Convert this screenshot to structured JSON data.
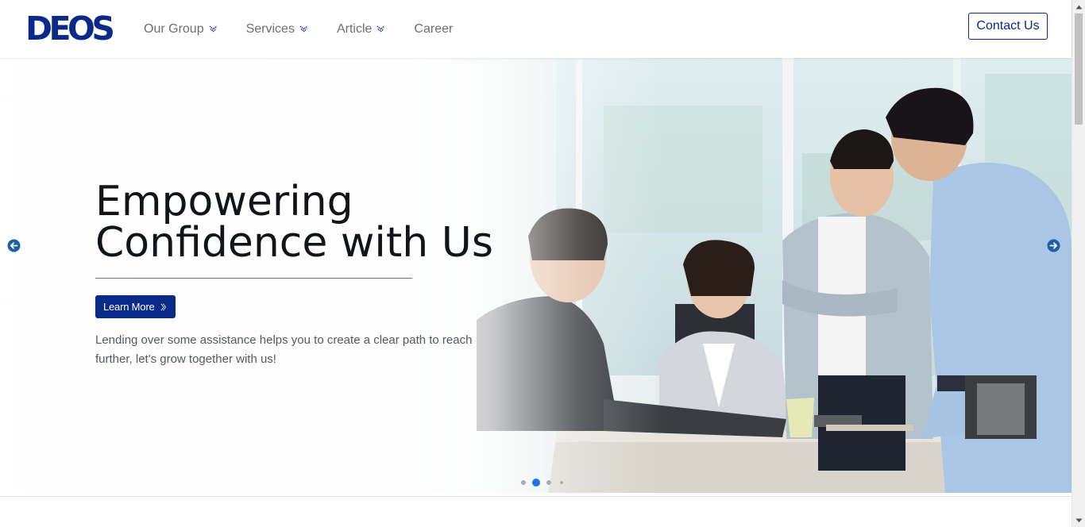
{
  "header": {
    "logo_text": "DEOS",
    "nav": [
      {
        "label": "Our Group",
        "has_dropdown": true
      },
      {
        "label": "Services",
        "has_dropdown": true
      },
      {
        "label": "Article",
        "has_dropdown": true
      },
      {
        "label": "Career",
        "has_dropdown": false
      }
    ],
    "contact_label": "Contact Us"
  },
  "hero": {
    "title_line1": "Empowering",
    "title_line2": "Confidence with Us",
    "button_label": "Learn More",
    "description": "Lending over some assistance helps you to create a clear path to reach further, let's grow together with us!",
    "slides_total": 4,
    "active_slide": 2
  },
  "icons": {
    "prev": "arrow-circle-left-icon",
    "next": "arrow-circle-right-icon",
    "dropdown": "chevron-down-icon",
    "button_arrow": "chevron-right-icon"
  },
  "colors": {
    "brand": "#0a2a8a",
    "arrow": "#1f5fa8",
    "dot_active": "#1a73e8",
    "dot_inactive": "#a8adb3"
  }
}
